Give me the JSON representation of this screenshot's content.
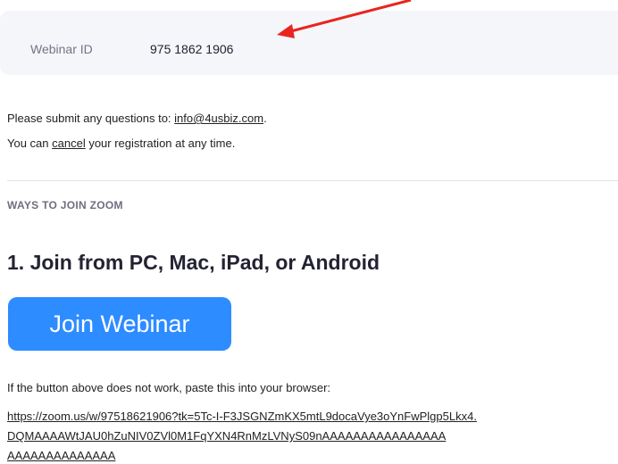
{
  "webinar": {
    "id_label": "Webinar ID",
    "id_value": "975 1862 1906"
  },
  "contact": {
    "prefix": "Please submit any questions to: ",
    "email": "info@4usbiz.com",
    "suffix": "."
  },
  "registration": {
    "prefix": "You can ",
    "cancel_link": "cancel",
    "suffix": " your registration at any time."
  },
  "section": {
    "title": "WAYS TO JOIN ZOOM",
    "heading": "1. Join from PC, Mac, iPad, or Android",
    "join_button": "Join Webinar",
    "fallback_text": "If the button above does not work, paste this into your browser:",
    "url_lines": [
      "https://zoom.us/w/97518621906?tk=5Tc-I-F3JSGNZmKX5mtL9docaVye3oYnFwPlgp5Lkx4.",
      "DQMAAAAWtJAU0hZuNIV0ZVl0M1FqYXN4RnMzLVNyS09nAAAAAAAAAAAAAAAA",
      "AAAAAAAAAAAAAA"
    ]
  },
  "colors": {
    "button": "#2d8cff",
    "annotation_arrow": "#e8251f",
    "id_box_bg": "#f5f6fa"
  }
}
